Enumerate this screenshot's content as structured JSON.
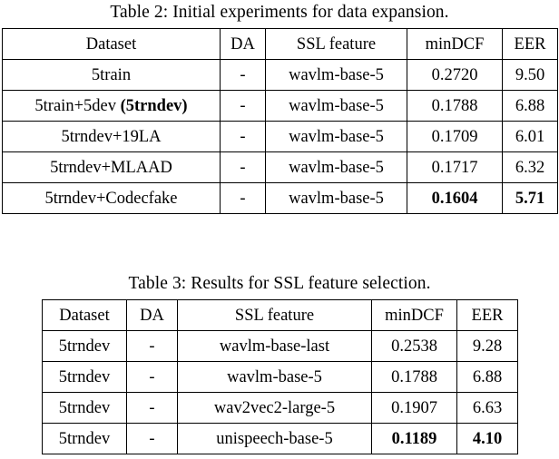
{
  "page": {
    "background": "#ffffff",
    "text_color": "#000000"
  },
  "table2": {
    "caption": "Table 2:  Initial experiments for data expansion.",
    "columns": [
      "Dataset",
      "DA",
      "SSL feature",
      "minDCF",
      "EER"
    ],
    "rows": [
      {
        "dataset": "5train",
        "dataset_bold_suffix": "",
        "da": "-",
        "ssl_feature": "wavlm-base-5",
        "mindcf": "0.2720",
        "eer": "9.50",
        "bold": false
      },
      {
        "dataset": "5train+5dev ",
        "dataset_bold_suffix": "(5trndev)",
        "da": "-",
        "ssl_feature": "wavlm-base-5",
        "mindcf": "0.1788",
        "eer": "6.88",
        "bold": false
      },
      {
        "dataset": "5trndev+19LA",
        "dataset_bold_suffix": "",
        "da": "-",
        "ssl_feature": "wavlm-base-5",
        "mindcf": "0.1709",
        "eer": "6.01",
        "bold": false
      },
      {
        "dataset": "5trndev+MLAAD",
        "dataset_bold_suffix": "",
        "da": "-",
        "ssl_feature": "wavlm-base-5",
        "mindcf": "0.1717",
        "eer": "6.32",
        "bold": false
      },
      {
        "dataset": "5trndev+Codecfake",
        "dataset_bold_suffix": "",
        "da": "-",
        "ssl_feature": "wavlm-base-5",
        "mindcf": "0.1604",
        "eer": "5.71",
        "bold": true
      }
    ]
  },
  "table3": {
    "caption": "Table 3:  Results for SSL feature selection.",
    "columns": [
      "Dataset",
      "DA",
      "SSL feature",
      "minDCF",
      "EER"
    ],
    "rows": [
      {
        "dataset": "5trndev",
        "da": "-",
        "ssl_feature": "wavlm-base-last",
        "mindcf": "0.2538",
        "eer": "9.28",
        "bold": false
      },
      {
        "dataset": "5trndev",
        "da": "-",
        "ssl_feature": "wavlm-base-5",
        "mindcf": "0.1788",
        "eer": "6.88",
        "bold": false
      },
      {
        "dataset": "5trndev",
        "da": "-",
        "ssl_feature": "wav2vec2-large-5",
        "mindcf": "0.1907",
        "eer": "6.63",
        "bold": false
      },
      {
        "dataset": "5trndev",
        "da": "-",
        "ssl_feature": "unispeech-base-5",
        "mindcf": "0.1189",
        "eer": "4.10",
        "bold": true
      }
    ]
  }
}
